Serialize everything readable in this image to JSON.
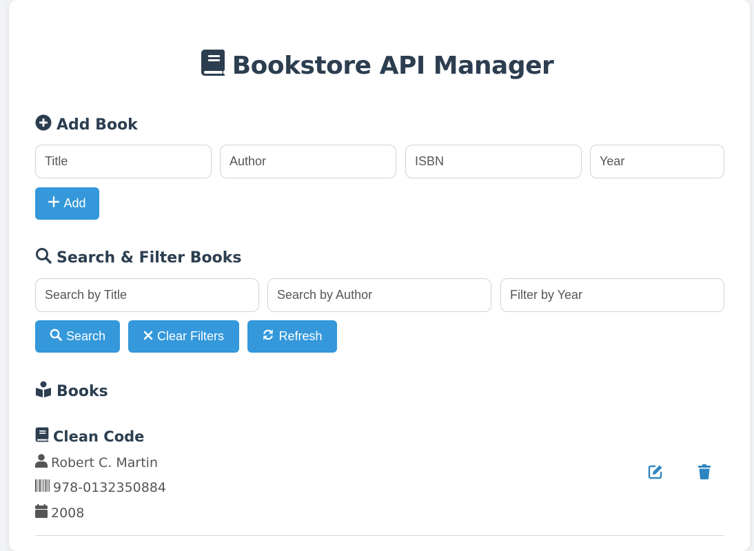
{
  "app": {
    "title": "Bookstore API Manager"
  },
  "add_section": {
    "heading": "Add Book",
    "title_placeholder": "Title",
    "author_placeholder": "Author",
    "isbn_placeholder": "ISBN",
    "year_placeholder": "Year",
    "add_label": "Add"
  },
  "search_section": {
    "heading": "Search & Filter Books",
    "title_placeholder": "Search by Title",
    "author_placeholder": "Search by Author",
    "year_placeholder": "Filter by Year",
    "search_label": "Search",
    "clear_label": "Clear Filters",
    "refresh_label": "Refresh"
  },
  "books_section": {
    "heading": "Books",
    "items": [
      {
        "title": "Clean Code",
        "author": "Robert C. Martin",
        "isbn": "978-0132350884",
        "year": "2008"
      }
    ]
  },
  "colors": {
    "primary": "#3498db",
    "text": "#2c3e50",
    "muted": "#555555"
  },
  "icons": {
    "title": "book-icon",
    "add_heading": "plus-circle-icon",
    "search_heading": "search-icon",
    "books_heading": "book-reader-icon",
    "author": "user-icon",
    "isbn": "barcode-icon",
    "year": "calendar-icon",
    "edit": "edit-icon",
    "delete": "trash-icon"
  }
}
